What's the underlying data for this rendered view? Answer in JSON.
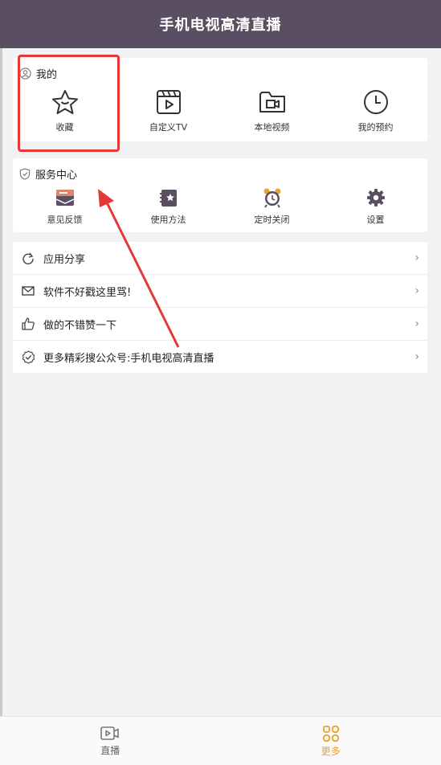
{
  "header": {
    "title": "手机电视高清直播"
  },
  "mine": {
    "title": "我的",
    "items": [
      {
        "label": "收藏",
        "icon": "star-icon"
      },
      {
        "label": "自定义TV",
        "icon": "video-file-icon"
      },
      {
        "label": "本地视频",
        "icon": "folder-video-icon"
      },
      {
        "label": "我的预约",
        "icon": "clock-icon"
      }
    ]
  },
  "service": {
    "title": "服务中心",
    "items": [
      {
        "label": "意见反馈",
        "icon": "feedback-icon"
      },
      {
        "label": "使用方法",
        "icon": "guide-icon"
      },
      {
        "label": "定时关闭",
        "icon": "alarm-clock-icon"
      },
      {
        "label": "设置",
        "icon": "gear-icon"
      }
    ]
  },
  "list": [
    {
      "label": "应用分享",
      "icon": "share-refresh-icon"
    },
    {
      "label": "软件不好戳这里骂!",
      "icon": "mail-icon"
    },
    {
      "label": "做的不错赞一下",
      "icon": "thumbs-up-icon"
    },
    {
      "label": "更多精彩搜公众号:手机电视高清直播",
      "icon": "verified-badge-icon"
    }
  ],
  "tabs": [
    {
      "label": "直播",
      "icon": "live-video-icon",
      "active": false
    },
    {
      "label": "更多",
      "icon": "more-grid-icon",
      "active": true
    }
  ],
  "colors": {
    "header_bg": "#5a4e63",
    "accent": "#e8a32e",
    "annotation": "#e53935"
  }
}
